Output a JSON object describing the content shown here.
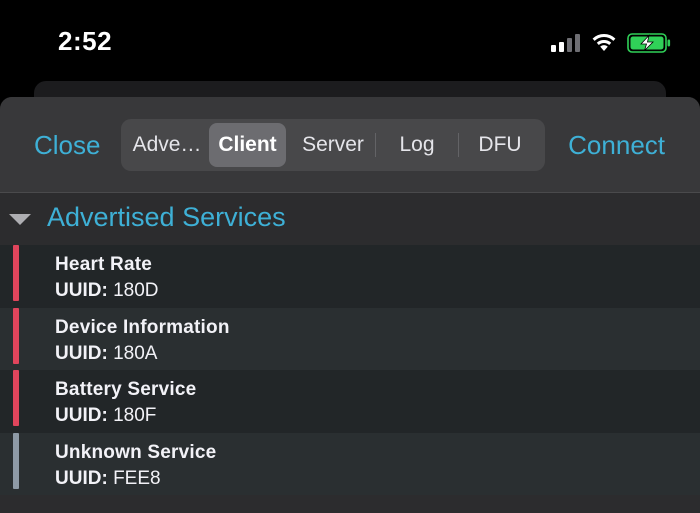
{
  "status_bar": {
    "time": "2:52",
    "signal_bars": 4,
    "signal_active_bars": 2,
    "battery_charging": true,
    "battery_color": "#30d158",
    "icons": [
      "signal-icon",
      "wifi-icon",
      "battery-charging-icon"
    ]
  },
  "nav": {
    "close_label": "Close",
    "connect_label": "Connect",
    "segments": [
      {
        "label": "Adve…",
        "selected": false
      },
      {
        "label": "Client",
        "selected": true
      },
      {
        "label": "Server",
        "selected": false
      },
      {
        "label": "Log",
        "selected": false
      },
      {
        "label": "DFU",
        "selected": false
      }
    ]
  },
  "section": {
    "title": "Advertised Services",
    "expanded": true,
    "uuid_prefix": "UUID:",
    "services": [
      {
        "name": "Heart Rate",
        "uuid": "180D",
        "accent": "#e0455c"
      },
      {
        "name": "Device Information",
        "uuid": "180A",
        "accent": "#e0455c"
      },
      {
        "name": "Battery Service",
        "uuid": "180F",
        "accent": "#e0455c"
      },
      {
        "name": "Unknown Service",
        "uuid": "FEE8",
        "accent": "#8e9aa6"
      }
    ]
  },
  "colors": {
    "accent_blue": "#3eb0d6",
    "background": "#000000",
    "sheet": "#2c2c2e"
  }
}
